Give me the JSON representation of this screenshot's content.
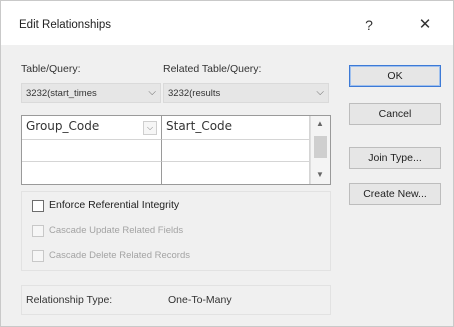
{
  "dialog": {
    "title": "Edit Relationships",
    "help_glyph": "?",
    "close_glyph": "✕"
  },
  "table_query": {
    "label": "Table/Query:",
    "value": "3232(start_times"
  },
  "related_table_query": {
    "label": "Related Table/Query:",
    "value": "3232(results"
  },
  "fields_grid": {
    "rows": [
      {
        "left": "Group_Code",
        "right": "Start_Code"
      },
      {
        "left": "",
        "right": ""
      },
      {
        "left": "",
        "right": ""
      }
    ]
  },
  "options": {
    "enforce_ri": {
      "label": "Enforce Referential Integrity",
      "checked": false
    },
    "cascade_update": {
      "label": "Cascade Update Related Fields",
      "checked": false
    },
    "cascade_delete": {
      "label": "Cascade Delete Related Records",
      "checked": false
    }
  },
  "relationship_type": {
    "label": "Relationship Type:",
    "value": "One-To-Many"
  },
  "buttons": {
    "ok": "OK",
    "cancel": "Cancel",
    "join_type": "Join Type...",
    "create_new": "Create New..."
  }
}
